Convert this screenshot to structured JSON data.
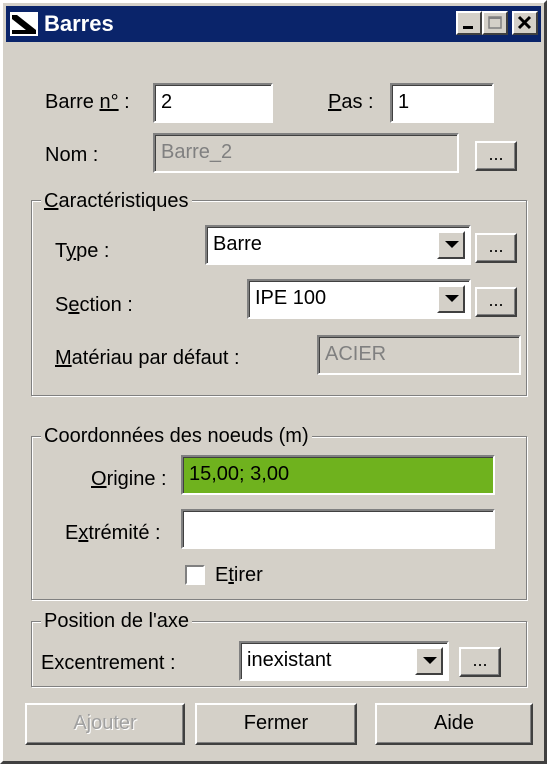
{
  "window": {
    "title": "Barres",
    "icons": [
      "bar-icon",
      "minimize-icon",
      "maximize-icon",
      "close-icon"
    ]
  },
  "header": {
    "barre_label_pre": "Barre ",
    "barre_label_u": "n°",
    "barre_label_post": " :",
    "barre_value": "2",
    "pas_label_u": "P",
    "pas_label_post": "as :",
    "pas_value": "1",
    "nom_label": "Nom :",
    "nom_value": "Barre_2",
    "nom_more": "..."
  },
  "caracteristiques": {
    "title_u": "C",
    "title_rest": "aractéristiques",
    "type_label_pre": "T",
    "type_label_u": "y",
    "type_label_post": "pe :",
    "type_value": "Barre",
    "type_more": "...",
    "section_label_pre": "S",
    "section_label_u": "e",
    "section_label_post": "ction :",
    "section_value": "IPE 100",
    "section_more": "...",
    "materiau_label_u": "M",
    "materiau_label_post": "atériau par défaut :",
    "materiau_value": "ACIER"
  },
  "coordonnees": {
    "title": "Coordonnées des noeuds (m)",
    "origine_label_u": "O",
    "origine_label_post": "rigine :",
    "origine_value": "15,00; 3,00",
    "extremite_label_pre": "E",
    "extremite_label_u": "x",
    "extremite_label_post": "trémité :",
    "extremite_value": "",
    "etirer_pre": "E",
    "etirer_u": "t",
    "etirer_post": "irer",
    "etirer_checked": false
  },
  "position": {
    "title": "Position de l'axe",
    "excentrement_label": "Excentrement :",
    "excentrement_value": "inexistant",
    "excentrement_more": "..."
  },
  "footer": {
    "ajouter": "Ajouter",
    "fermer": "Fermer",
    "aide": "Aide"
  },
  "colors": {
    "titlebar": "#0a246a",
    "dialog": "#d4d0c8",
    "origine_highlight": "#6fb21e"
  }
}
